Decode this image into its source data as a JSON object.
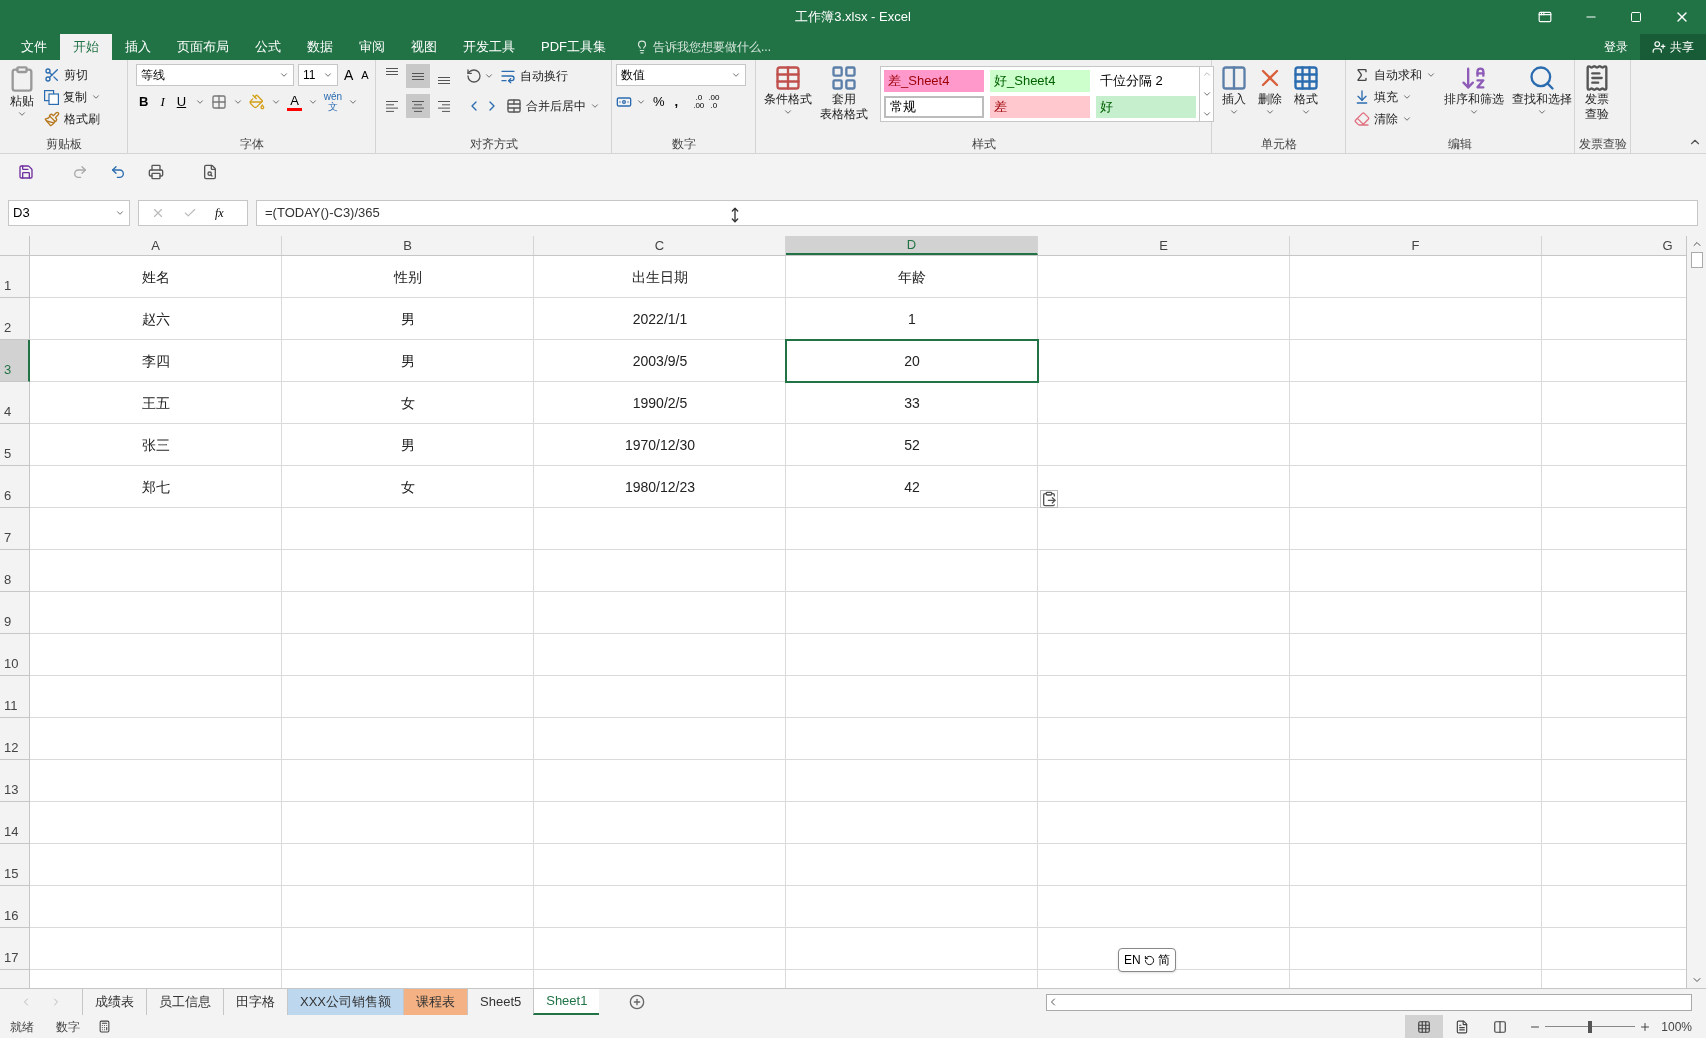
{
  "window": {
    "title": "工作簿3.xlsx - Excel"
  },
  "menu_tabs": [
    {
      "label": "文件",
      "selected": false
    },
    {
      "label": "开始",
      "selected": true
    },
    {
      "label": "插入",
      "selected": false
    },
    {
      "label": "页面布局",
      "selected": false
    },
    {
      "label": "公式",
      "selected": false
    },
    {
      "label": "数据",
      "selected": false
    },
    {
      "label": "审阅",
      "selected": false
    },
    {
      "label": "视图",
      "selected": false
    },
    {
      "label": "开发工具",
      "selected": false
    },
    {
      "label": "PDF工具集",
      "selected": false
    }
  ],
  "tell_me": {
    "placeholder": "告诉我您想要做什么..."
  },
  "account": {
    "sign_in": "登录",
    "share": "共享"
  },
  "ribbon": {
    "clipboard": {
      "label": "剪贴板",
      "paste": "粘贴",
      "cut": "剪切",
      "copy": "复制",
      "format_painter": "格式刷"
    },
    "font": {
      "label": "字体",
      "name": "等线",
      "size": "11",
      "grow": "A",
      "shrink": "A",
      "bold": "B",
      "italic": "I",
      "underline": "U",
      "font_color": "A",
      "phonetic_top": "wén",
      "phonetic_bottom": "文"
    },
    "alignment": {
      "label": "对齐方式",
      "wrap": "自动换行",
      "merge": "合并后居中",
      "vertical": [
        {
          "kind": "top",
          "selected": false
        },
        {
          "kind": "middle",
          "selected": true
        },
        {
          "kind": "bottom",
          "selected": false
        }
      ],
      "horizontal": [
        {
          "kind": "left",
          "selected": false
        },
        {
          "kind": "center",
          "selected": true
        },
        {
          "kind": "right",
          "selected": false
        }
      ]
    },
    "number": {
      "label": "数字",
      "format": "数值",
      "percent": "%",
      "comma": ",",
      "increase_decimal": [
        ".0",
        ".00"
      ],
      "decrease_decimal": [
        ".00",
        ".0"
      ]
    },
    "styles": {
      "label": "样式",
      "conditional": "条件格式",
      "table_top": "套用",
      "table_bottom": "表格格式",
      "gallery": [
        {
          "label": "差_Sheet4",
          "kind": "bad",
          "color": "#ff99cc",
          "selected": false
        },
        {
          "label": "好_Sheet4",
          "kind": "good",
          "color": "#ccffcc",
          "selected": false
        },
        {
          "label": "千位分隔 2",
          "kind": "normal",
          "color": "#ffffff",
          "selected": false
        },
        {
          "label": "常规",
          "kind": "normal",
          "color": "#ffffff",
          "selected": true
        },
        {
          "label": "差",
          "kind": "bad",
          "color": "#ffc7ce",
          "selected": false
        },
        {
          "label": "好",
          "kind": "good",
          "color": "#c6efce",
          "selected": false
        }
      ]
    },
    "cells": {
      "label": "单元格",
      "insert": "插入",
      "delete": "删除",
      "format": "格式"
    },
    "editing": {
      "label": "编辑",
      "autosum": "自动求和",
      "fill": "填充",
      "clear": "清除",
      "sort": "排序和筛选",
      "find": "查找和选择"
    },
    "invoice": {
      "label": "发票查验",
      "top": "发票",
      "bottom": "查验"
    }
  },
  "formula_bar": {
    "name_box": "D3",
    "fx": "fx",
    "formula": "=(TODAY()-C3)/365"
  },
  "columns": [
    {
      "label": "A",
      "selected": false
    },
    {
      "label": "B",
      "selected": false
    },
    {
      "label": "C",
      "selected": false
    },
    {
      "label": "D",
      "selected": true
    },
    {
      "label": "E",
      "selected": false
    },
    {
      "label": "F",
      "selected": false
    },
    {
      "label": "G",
      "selected": false
    }
  ],
  "rows": [
    {
      "header": "1",
      "selected": false,
      "cells": [
        {
          "text": "姓名",
          "active": false
        },
        {
          "text": "性别",
          "active": false
        },
        {
          "text": "出生日期",
          "active": false
        },
        {
          "text": "年龄",
          "active": false
        }
      ]
    },
    {
      "header": "2",
      "selected": false,
      "cells": [
        {
          "text": "赵六",
          "active": false
        },
        {
          "text": "男",
          "active": false
        },
        {
          "text": "2022/1/1",
          "active": false
        },
        {
          "text": "1",
          "active": false
        }
      ]
    },
    {
      "header": "3",
      "selected": true,
      "cells": [
        {
          "text": "李四",
          "active": false
        },
        {
          "text": "男",
          "active": false
        },
        {
          "text": "2003/9/5",
          "active": false
        },
        {
          "text": "20",
          "active": true
        }
      ]
    },
    {
      "header": "4",
      "selected": false,
      "cells": [
        {
          "text": "王五",
          "active": false
        },
        {
          "text": "女",
          "active": false
        },
        {
          "text": "1990/2/5",
          "active": false
        },
        {
          "text": "33",
          "active": false
        }
      ]
    },
    {
      "header": "5",
      "selected": false,
      "cells": [
        {
          "text": "张三",
          "active": false
        },
        {
          "text": "男",
          "active": false
        },
        {
          "text": "1970/12/30",
          "active": false
        },
        {
          "text": "52",
          "active": false
        }
      ]
    },
    {
      "header": "6",
      "selected": false,
      "cells": [
        {
          "text": "郑七",
          "active": false
        },
        {
          "text": "女",
          "active": false
        },
        {
          "text": "1980/12/23",
          "active": false
        },
        {
          "text": "42",
          "active": false
        }
      ]
    },
    {
      "header": "7",
      "selected": false
    },
    {
      "header": "8",
      "selected": false
    },
    {
      "header": "9",
      "selected": false
    },
    {
      "header": "10",
      "selected": false
    },
    {
      "header": "11",
      "selected": false
    },
    {
      "header": "12",
      "selected": false
    },
    {
      "header": "13",
      "selected": false
    },
    {
      "header": "14",
      "selected": false
    },
    {
      "header": "15",
      "selected": false
    },
    {
      "header": "16",
      "selected": false
    },
    {
      "header": "17",
      "selected": false
    }
  ],
  "ime": {
    "lang": "EN",
    "mode": "简"
  },
  "sheet_tabs": [
    {
      "label": "成绩表",
      "selected": false
    },
    {
      "label": "员工信息",
      "selected": false
    },
    {
      "label": "田字格",
      "selected": false
    },
    {
      "label": "XXX公司销售额",
      "selected": false,
      "color": "#bdd7ee"
    },
    {
      "label": "课程表",
      "selected": false,
      "color": "#f4b183"
    },
    {
      "label": "Sheet5",
      "selected": false
    },
    {
      "label": "Sheet1",
      "selected": true
    }
  ],
  "status_bar": {
    "ready": "就绪",
    "mode": "数字",
    "views": [
      {
        "kind": "normal",
        "selected": true
      },
      {
        "kind": "page_layout",
        "selected": false
      },
      {
        "kind": "page_break",
        "selected": false
      }
    ],
    "zoom": {
      "level": 0.5,
      "reading": "100%"
    }
  }
}
